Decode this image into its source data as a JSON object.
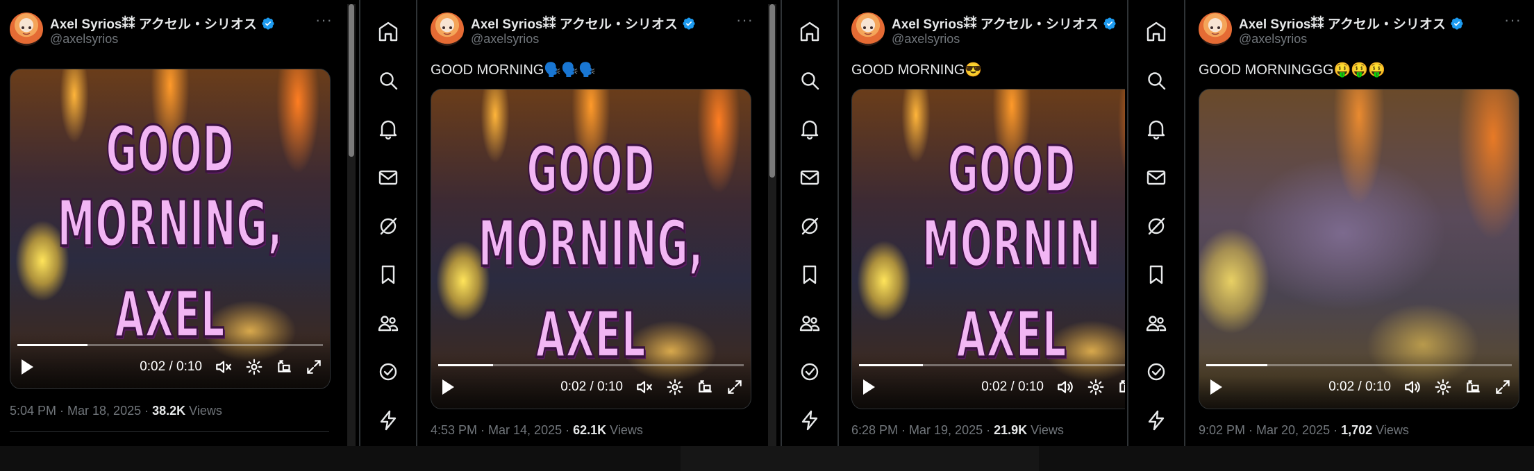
{
  "author": {
    "display_name": "Axel Syrios⁑⁑ アクセル・シリオス",
    "handle": "@axelsyrios",
    "verified": true,
    "verified_color": "#1d9bf0"
  },
  "more_label": "···",
  "nav_icons": [
    "home-icon",
    "search-icon",
    "bell-icon",
    "mail-icon",
    "grok-icon",
    "bookmark-icon",
    "communities-icon",
    "verified-icon",
    "lightning-icon"
  ],
  "tweets": [
    {
      "text": "",
      "video_caption_line1": "GOOD MORNING,",
      "video_caption_line2": "AXEL",
      "time": "0:02 / 0:10",
      "progress": 0.23,
      "muted": true,
      "timestamp": "5:04 PM · Mar 18, 2025 · ",
      "views_count": "38.2K",
      "views_label": " Views"
    },
    {
      "text": "GOOD MORNING🗣️🗣️🗣️",
      "video_caption_line1": "GOOD MORNING,",
      "video_caption_line2": "AXEL",
      "time": "0:02 / 0:10",
      "progress": 0.18,
      "muted": true,
      "timestamp": "4:53 PM · Mar 14, 2025 · ",
      "views_count": "62.1K",
      "views_label": " Views"
    },
    {
      "text": "GOOD MORNING😎",
      "video_caption_line1": "GOOD MORNIN",
      "video_caption_line2": "AXEL",
      "time": "0:02 / 0:10",
      "progress": 0.21,
      "muted": false,
      "timestamp": "6:28 PM · Mar 19, 2025 · ",
      "views_count": "21.9K",
      "views_label": " Views"
    },
    {
      "text": "GOOD MORNINGGG🤑🤑🤑",
      "video_caption_line1": "",
      "video_caption_line2": "",
      "time": "0:02 / 0:10",
      "progress": 0.2,
      "muted": false,
      "timestamp": "9:02 PM · Mar 20, 2025 · ",
      "views_count": "1,702",
      "views_label": " Views"
    }
  ]
}
